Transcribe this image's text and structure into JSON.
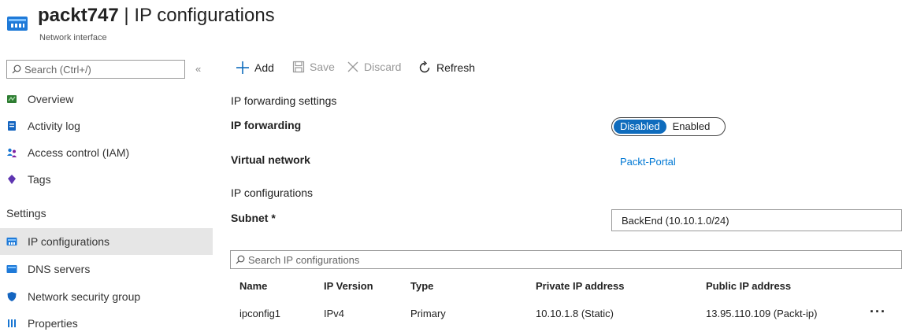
{
  "header": {
    "resource_name": "packt747",
    "separator": " | ",
    "page": "IP configurations",
    "subtitle": "Network interface"
  },
  "sidebar": {
    "search_placeholder": "Search (Ctrl+/)",
    "collapse": "«",
    "items": [
      {
        "label": "Overview",
        "icon": "overview-icon"
      },
      {
        "label": "Activity log",
        "icon": "activity-log-icon"
      },
      {
        "label": "Access control (IAM)",
        "icon": "iam-icon"
      },
      {
        "label": "Tags",
        "icon": "tag-icon"
      }
    ],
    "section": "Settings",
    "settings_items": [
      {
        "label": "IP configurations",
        "icon": "ip-config-icon",
        "selected": true
      },
      {
        "label": "DNS servers",
        "icon": "dns-icon"
      },
      {
        "label": "Network security group",
        "icon": "shield-icon"
      },
      {
        "label": "Properties",
        "icon": "properties-icon"
      }
    ]
  },
  "toolbar": {
    "add": "Add",
    "save": "Save",
    "discard": "Discard",
    "refresh": "Refresh"
  },
  "main": {
    "ip_forwarding_section": "IP forwarding settings",
    "ip_forwarding_label": "IP forwarding",
    "toggle": {
      "disabled": "Disabled",
      "enabled": "Enabled",
      "selected": "Disabled"
    },
    "virtual_network_label": "Virtual network",
    "virtual_network_value": "Packt-Portal",
    "ip_config_section": "IP configurations",
    "subnet_label": "Subnet *",
    "subnet_value": "BackEnd (10.10.1.0/24)",
    "search_placeholder": "Search IP configurations"
  },
  "table": {
    "headers": [
      "Name",
      "IP Version",
      "Type",
      "Private IP address",
      "Public IP address"
    ],
    "rows": [
      [
        "ipconfig1",
        "IPv4",
        "Primary",
        "10.10.1.8 (Static)",
        "13.95.110.109 (Packt-ip)"
      ]
    ],
    "more": "···"
  },
  "colors": {
    "accent": "#0f6cbd",
    "link": "#0078d4",
    "selected_bg": "#e6e6e6"
  }
}
